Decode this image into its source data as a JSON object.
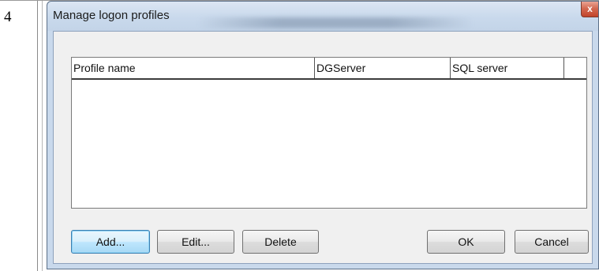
{
  "document": {
    "row_number": "4"
  },
  "dialog": {
    "title": "Manage logon profiles",
    "close_glyph": "x",
    "list": {
      "columns": [
        "Profile name",
        "DGServer",
        "SQL server"
      ],
      "rows": []
    },
    "buttons": {
      "add": "Add...",
      "edit": "Edit...",
      "delete": "Delete",
      "ok": "OK",
      "cancel": "Cancel"
    }
  }
}
